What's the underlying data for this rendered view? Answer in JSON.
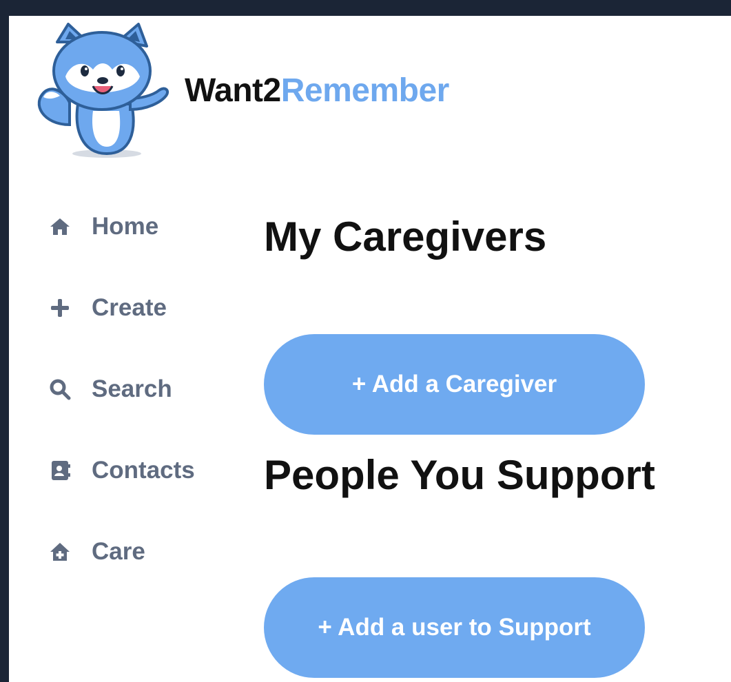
{
  "brand": {
    "name_part1": "Want2",
    "name_part2": "Remember",
    "logo_icon": "fox-mascot-logo",
    "accent_color": "#6ea8ee"
  },
  "sidebar": {
    "items": [
      {
        "label": "Home",
        "icon": "home-icon"
      },
      {
        "label": "Create",
        "icon": "plus-icon"
      },
      {
        "label": "Search",
        "icon": "search-icon"
      },
      {
        "label": "Contacts",
        "icon": "contact-book-icon"
      },
      {
        "label": "Care",
        "icon": "care-house-icon"
      }
    ]
  },
  "main": {
    "caregivers_title": "My Caregivers",
    "add_caregiver_label": "+ Add a Caregiver",
    "support_title": "People You Support",
    "add_support_label": "+ Add a user to Support",
    "button_color": "#6faaf0"
  }
}
